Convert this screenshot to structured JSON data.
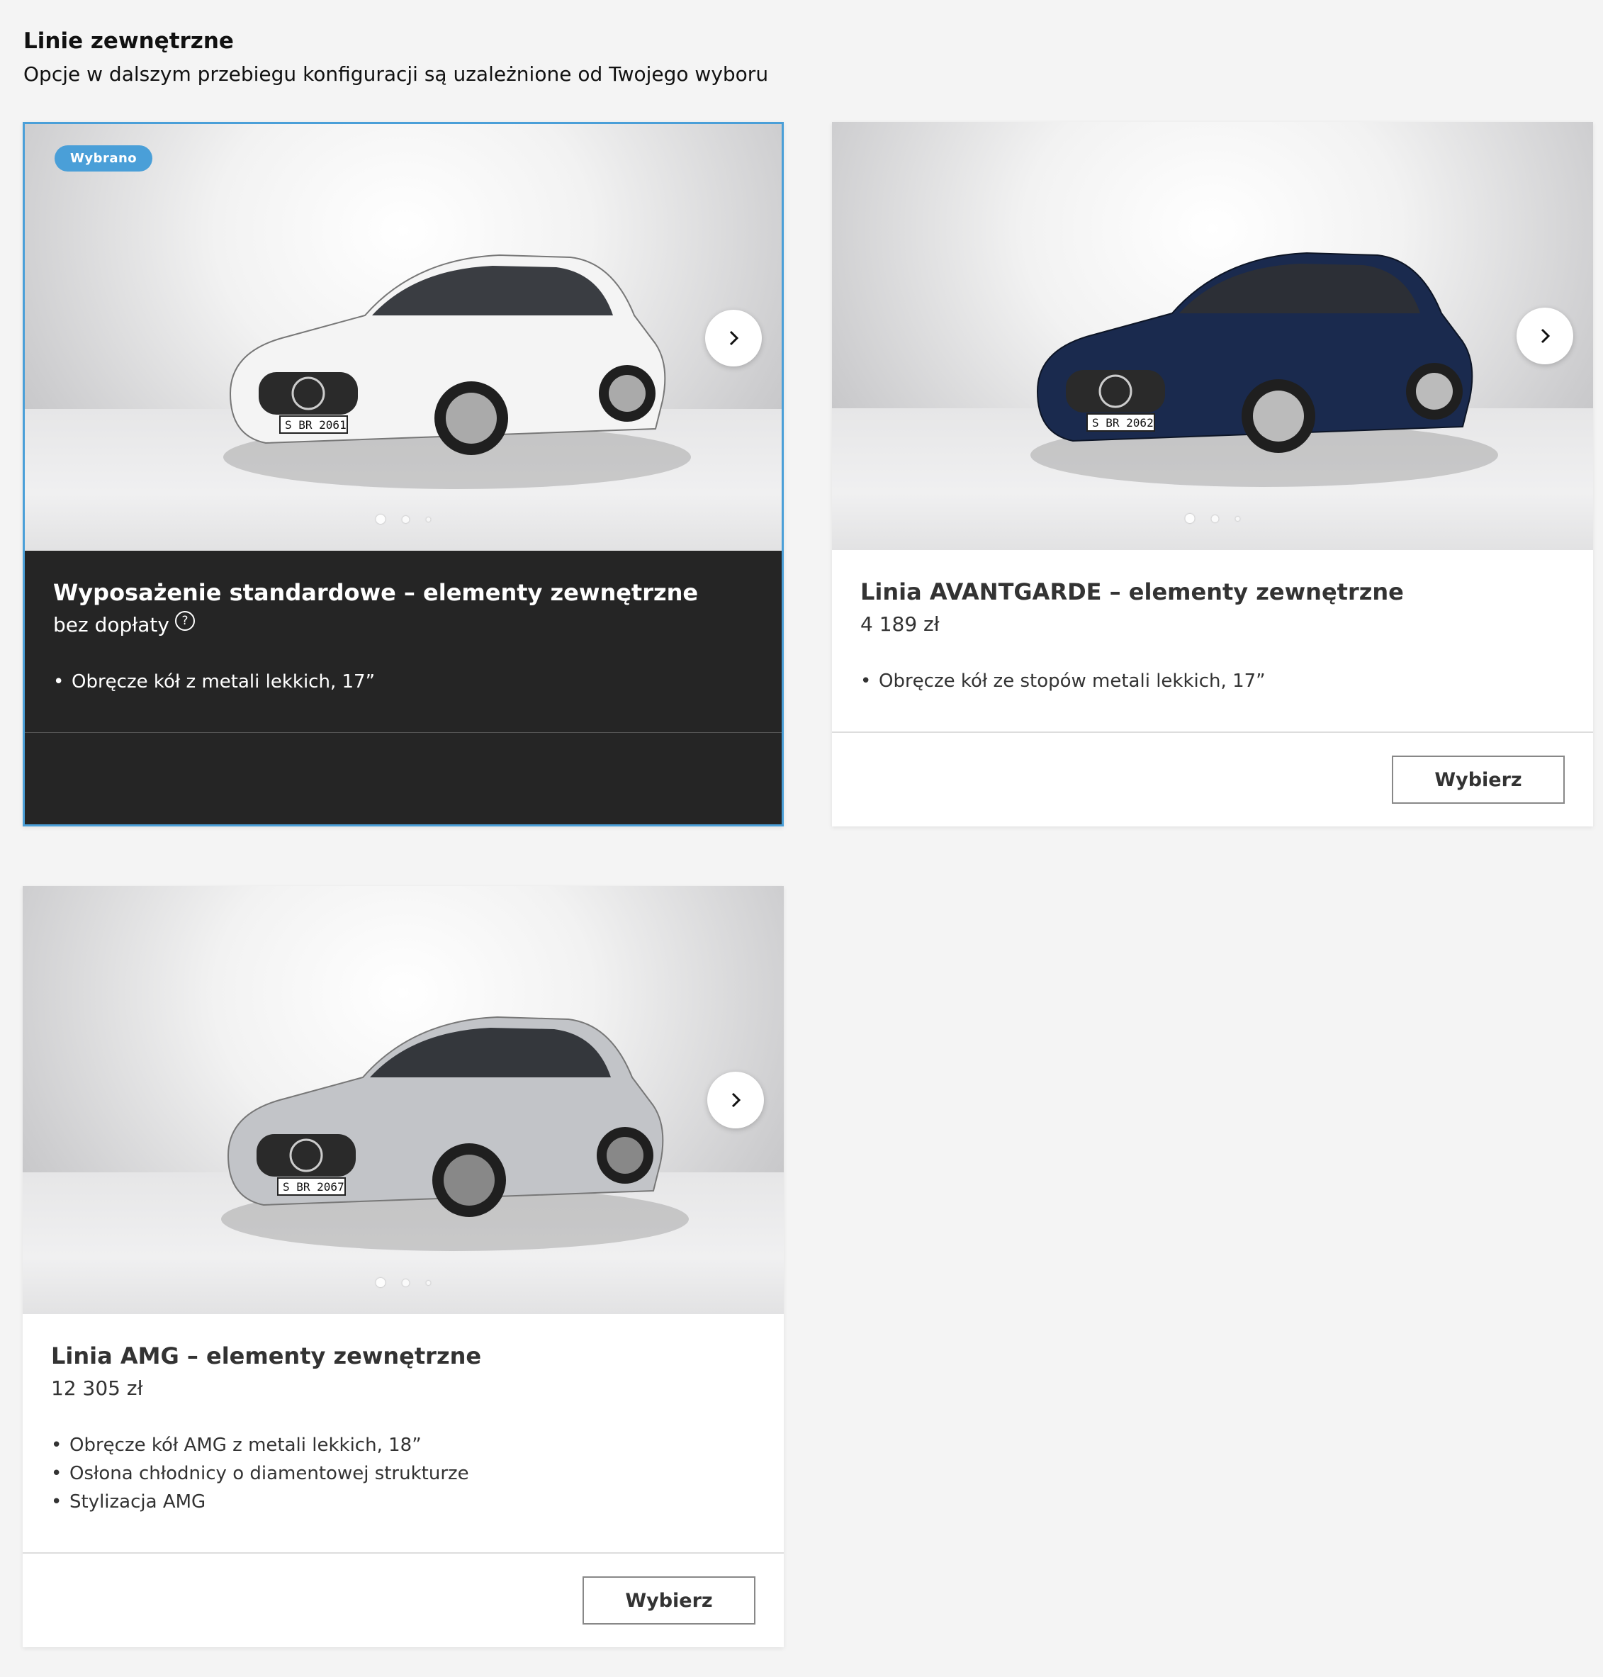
{
  "header": {
    "title": "Linie zewnętrzne",
    "subtitle": "Opcje w dalszym przebiegu konfiguracji są uzależnione od Twojego wyboru"
  },
  "cards": [
    {
      "badge": "Wybrano",
      "plate": "S BR 2061",
      "car_color": "#f4f4f4",
      "title": "Wyposażenie standardowe – elementy zewnętrzne",
      "price": "bez dopłaty",
      "help_icon": "?",
      "features": [
        "Obręcze kół z metali lekkich, 17”"
      ],
      "selected": true
    },
    {
      "plate": "S BR 2062",
      "car_color": "#1a2a4e",
      "title": "Linia AVANTGARDE – elementy zewnętrzne",
      "price": "4 189 zł",
      "features": [
        "Obręcze kół ze stopów metali lekkich, 17”"
      ],
      "button": "Wybierz"
    },
    {
      "plate": "S BR 2067",
      "car_color": "#c2c4c8",
      "title": "Linia AMG – elementy zewnętrzne",
      "price": "12 305 zł",
      "features": [
        "Obręcze kół AMG z metali lekkich, 18”",
        "Osłona chłodnicy o diamentowej strukturze",
        "Stylizacja AMG"
      ],
      "button": "Wybierz"
    }
  ],
  "icons": {
    "next": "chevron-right-icon",
    "help": "question-circle-icon"
  },
  "colors": {
    "accent": "#4a9fd8",
    "selected_bg": "#252525"
  }
}
